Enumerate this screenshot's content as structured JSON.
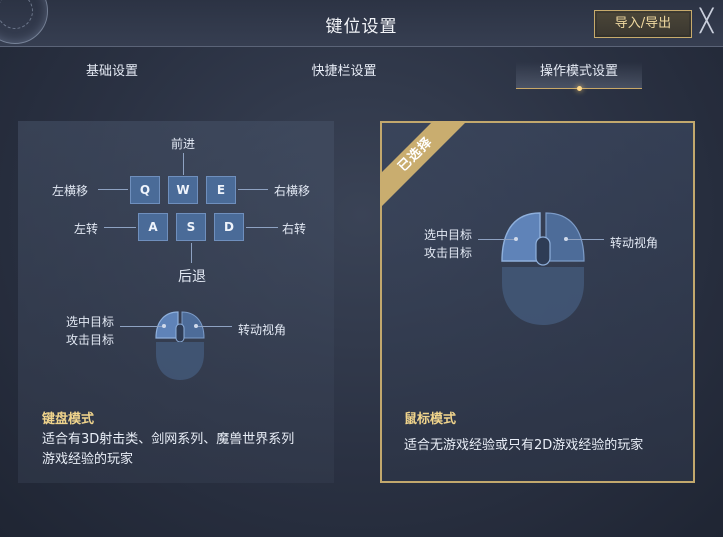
{
  "header": {
    "title": "键位设置",
    "import_export_label": "导入/导出",
    "close_glyph": "╳"
  },
  "tabs": [
    {
      "label": "基础设置",
      "active": false
    },
    {
      "label": "快捷栏设置",
      "active": false
    },
    {
      "label": "操作模式设置",
      "active": true
    }
  ],
  "keyboard_card": {
    "keys_top": [
      "Q",
      "W",
      "E"
    ],
    "keys_bottom": [
      "A",
      "S",
      "D"
    ],
    "labels": {
      "forward": "前进",
      "strafe_left": "左横移",
      "strafe_right": "右横移",
      "turn_left": "左转",
      "turn_right": "右转",
      "backward": "后退"
    },
    "mouse_labels": {
      "select_target": "选中目标",
      "attack_target": "攻击目标",
      "rotate_view": "转动视角"
    },
    "mode_title": "键盘模式",
    "mode_desc_line1": "适合有3D射击类、剑网系列、魔兽世界系列",
    "mode_desc_line2": "游戏经验的玩家"
  },
  "mouse_card": {
    "selected_badge": "已选择",
    "selected": true,
    "mouse_labels": {
      "select_target": "选中目标",
      "attack_target": "攻击目标",
      "rotate_view": "转动视角"
    },
    "mode_title": "鼠标模式",
    "mode_desc": "适合无游戏经验或只有2D游戏经验的玩家"
  },
  "colors": {
    "accent_gold": "#c9ad6f",
    "key_blue": "#4a6b98",
    "mode_title": "#f0d48c"
  }
}
